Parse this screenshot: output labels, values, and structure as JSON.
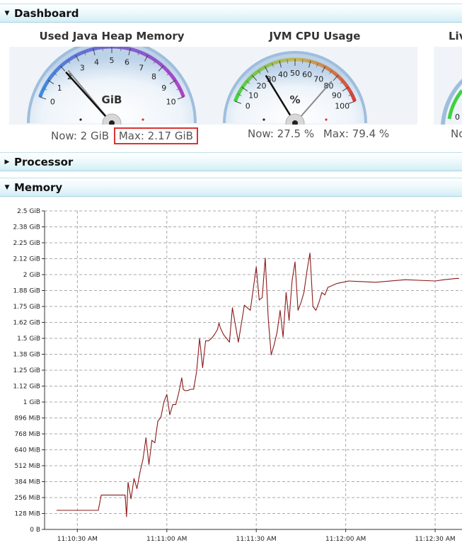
{
  "sections": {
    "dashboard": {
      "title": "Dashboard",
      "expanded": true
    },
    "processor": {
      "title": "Processor",
      "expanded": false
    },
    "memory": {
      "title": "Memory",
      "expanded": true
    }
  },
  "gauges": {
    "heap": {
      "title": "Used Java Heap Memory",
      "unit": "GiB",
      "ticks": [
        "0",
        "1",
        "2",
        "3",
        "4",
        "5",
        "6",
        "7",
        "8",
        "9",
        "10"
      ],
      "range": [
        0,
        10
      ],
      "value": 2,
      "max_value": 2.17,
      "now_text": "Now: 2 GiB",
      "max_text": "Max: 2.17 GiB"
    },
    "cpu": {
      "title": "JVM CPU Usage",
      "unit": "%",
      "ticks": [
        "0",
        "10",
        "20",
        "30",
        "40",
        "50",
        "60",
        "70",
        "80",
        "90",
        "100"
      ],
      "range": [
        0,
        100
      ],
      "value": 27.5,
      "max_value": 79.4,
      "now_text": "Now: 27.5 %",
      "max_text": "Max: 79.4 %"
    },
    "third": {
      "title": "Liv",
      "now_text": "No"
    }
  },
  "colors": {
    "heap_arc_start": "#3a8be0",
    "heap_arc_end": "#b43cc6",
    "cpu_arc_start": "#3fd23f",
    "cpu_arc_end": "#d93434",
    "series_line": "#8b1a1a",
    "header_border": "#a9d3e0"
  },
  "chart_data": {
    "type": "line",
    "title": "",
    "xlabel": "",
    "ylabel": "",
    "y_ticks": [
      "0 B",
      "128 MiB",
      "256 MiB",
      "384 MiB",
      "512 MiB",
      "640 MiB",
      "768 MiB",
      "896 MiB",
      "1 GiB",
      "1.12 GiB",
      "1.25 GiB",
      "1.38 GiB",
      "1.5 GiB",
      "1.62 GiB",
      "1.75 GiB",
      "1.88 GiB",
      "2 GiB",
      "2.12 GiB",
      "2.25 GiB",
      "2.38 GiB",
      "2.5 GiB"
    ],
    "ylim_gib": [
      0,
      2.5
    ],
    "x_ticks": [
      "11:10:30 AM",
      "11:11:00 AM",
      "11:11:30 AM",
      "11:12:00 AM",
      "11:12:30 AM"
    ],
    "x_tick_seconds": [
      30,
      60,
      90,
      120,
      150
    ],
    "grid": true,
    "series": [
      {
        "x_seconds": [
          23,
          37,
          38,
          46,
          46.5,
          47,
          48,
          49,
          50,
          51,
          52,
          53,
          54,
          55,
          56,
          57,
          58,
          59,
          60,
          61,
          62,
          63,
          64,
          65,
          65.5,
          66,
          67,
          68,
          69,
          70,
          71,
          72,
          73,
          74,
          75,
          76,
          77,
          77.5,
          78,
          79,
          80,
          81,
          82,
          84,
          86,
          88,
          90,
          91,
          92,
          93,
          94,
          95,
          96,
          97,
          98,
          99,
          100,
          101,
          102,
          103,
          104,
          105,
          106,
          107,
          108,
          109,
          110,
          111,
          112,
          113,
          114,
          115,
          116,
          117,
          119,
          121,
          130,
          140,
          150,
          153,
          157,
          158
        ],
        "y_gib": [
          0.15,
          0.15,
          0.27,
          0.27,
          0.1,
          0.37,
          0.24,
          0.4,
          0.32,
          0.45,
          0.55,
          0.72,
          0.51,
          0.7,
          0.68,
          0.85,
          0.88,
          1.0,
          1.06,
          0.9,
          0.98,
          0.98,
          1.07,
          1.19,
          1.1,
          1.09,
          1.09,
          1.1,
          1.1,
          1.24,
          1.5,
          1.27,
          1.48,
          1.48,
          1.5,
          1.53,
          1.57,
          1.62,
          1.58,
          1.53,
          1.5,
          1.47,
          1.74,
          1.47,
          1.76,
          1.72,
          2.06,
          1.8,
          1.82,
          2.13,
          1.66,
          1.37,
          1.45,
          1.55,
          1.72,
          1.51,
          1.86,
          1.64,
          1.95,
          2.1,
          1.72,
          1.78,
          1.86,
          2.03,
          2.17,
          1.75,
          1.72,
          1.78,
          1.86,
          1.84,
          1.9,
          1.91,
          1.92,
          1.93,
          1.94,
          1.95,
          1.94,
          1.96,
          1.95,
          1.96,
          1.97,
          1.97,
          2.0
        ]
      }
    ]
  }
}
